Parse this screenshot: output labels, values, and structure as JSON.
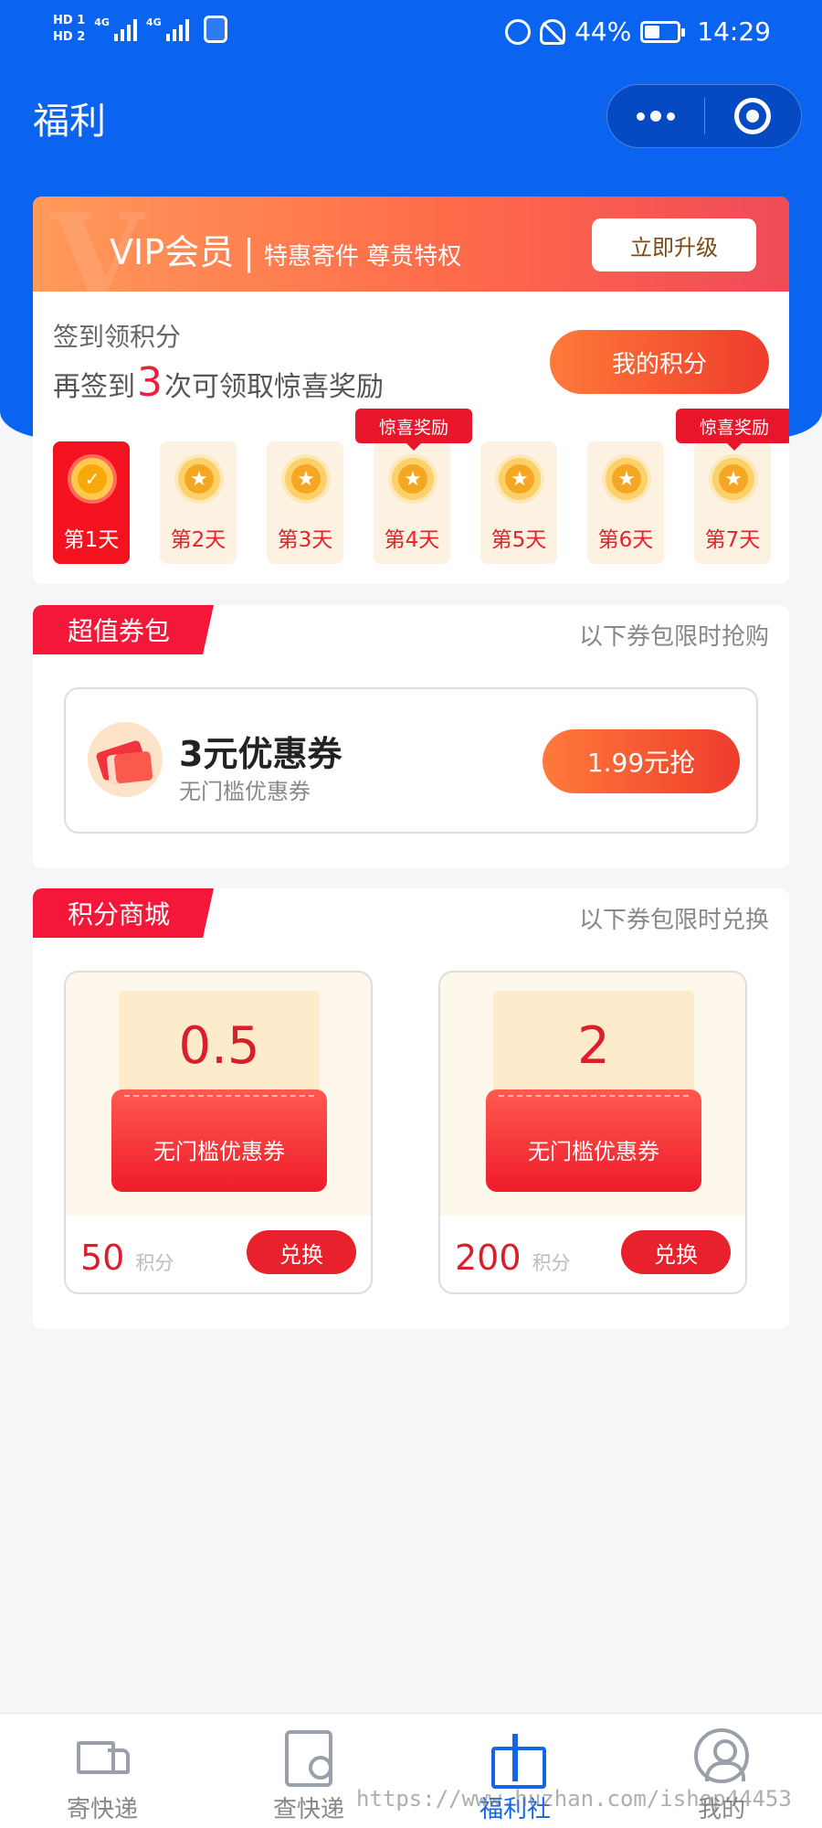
{
  "status_bar": {
    "hd1": "HD 1",
    "hd2": "HD 2",
    "net1": "4G",
    "net2": "4G",
    "battery": "44%",
    "time": "14:29"
  },
  "header": {
    "title": "福利"
  },
  "vip": {
    "title": "VIP会员",
    "separator": "|",
    "subtitle": "特惠寄件 尊贵特权",
    "upgrade_label": "立即升级"
  },
  "signin": {
    "title": "签到领积分",
    "sub_prefix": "再签到",
    "sub_count": "3",
    "sub_suffix": "次可领取惊喜奖励",
    "my_points_label": "我的积分",
    "surprise_label": "惊喜奖励",
    "days": [
      "第1天",
      "第2天",
      "第3天",
      "第4天",
      "第5天",
      "第6天",
      "第7天"
    ]
  },
  "coupon_pack": {
    "tag": "超值券包",
    "note": "以下券包限时抢购",
    "item": {
      "title": "3元优惠券",
      "desc": "无门槛优惠券",
      "buy_label": "1.99元抢"
    }
  },
  "mall": {
    "tag": "积分商城",
    "note": "以下券包限时兑换",
    "items": [
      {
        "value": "0.5",
        "label": "无门槛优惠券",
        "points": "50",
        "unit": "积分",
        "redeem_label": "兑换"
      },
      {
        "value": "2",
        "label": "无门槛优惠券",
        "points": "200",
        "unit": "积分",
        "redeem_label": "兑换"
      }
    ]
  },
  "tabbar": {
    "items": [
      "寄快递",
      "查快递",
      "福利社",
      "我的"
    ]
  },
  "watermark": "https://www.huzhan.com/ishop44453"
}
